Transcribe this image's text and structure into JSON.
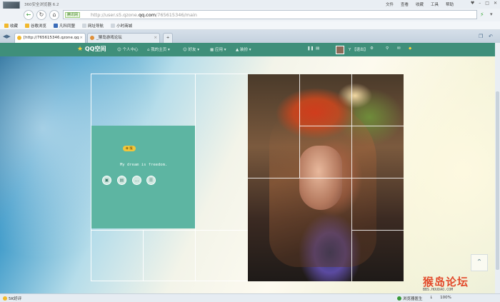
{
  "browser": {
    "title": "360安全浏览器 6.2",
    "menu": [
      "文件",
      "查看",
      "收藏",
      "工具",
      "帮助"
    ],
    "win_buttons": [
      "♥",
      "–",
      "□",
      "✕"
    ]
  },
  "address": {
    "badge": "腾讯网",
    "url_prefix": "http://user.s5.qzone.",
    "url_domain": "qq.com",
    "url_suffix": "/765615346/main"
  },
  "favorites": {
    "bookmarks_label": "收藏",
    "items": [
      "谷歌浏览",
      "凡科同盟",
      "网址导航",
      "小时商城"
    ]
  },
  "tabs": [
    {
      "label": "[http://765615346.qzone.qq",
      "active": true
    },
    {
      "label": "_猴岛游戏论坛",
      "active": false
    }
  ],
  "qzone": {
    "logo": "QQ空间",
    "nav": [
      "个人中心",
      "我的主页",
      "好友",
      "应用",
      "装扮"
    ],
    "user": "Y 【退出】"
  },
  "profile": {
    "tag": "✿ 猴",
    "motto": "My dream is freedom."
  },
  "watermark": {
    "big": "猴岛论坛",
    "small": "BBS.HOUDAO.COM"
  },
  "status": {
    "left": "5K好评",
    "right": [
      "浏览器医生",
      "↓",
      "100%"
    ]
  },
  "colors": {
    "qq_bar": "#3f8f7a",
    "teal_panel": "#5db5a2",
    "watermark_red": "#e24a2b"
  }
}
